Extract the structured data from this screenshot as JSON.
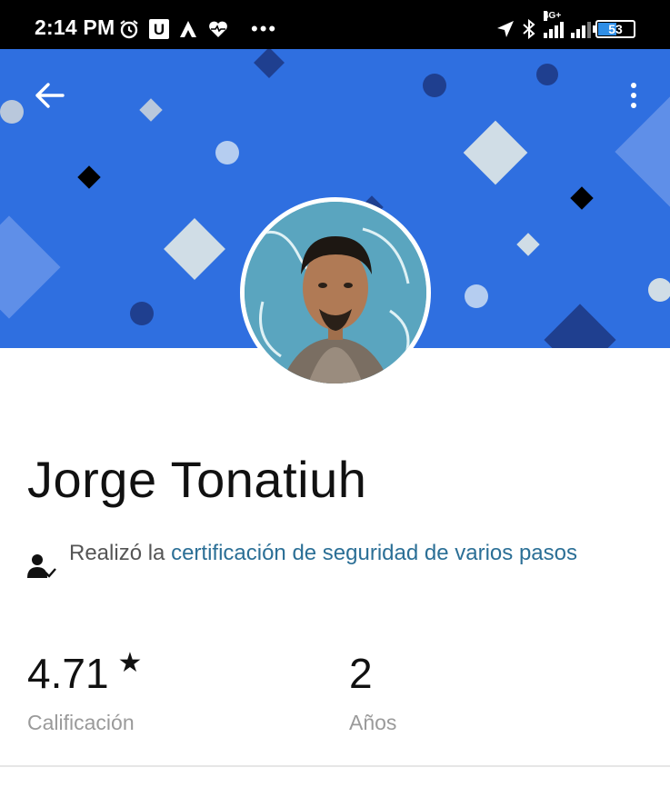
{
  "status_bar": {
    "time": "2:14 PM",
    "u_label": "U",
    "more_label": "•••",
    "network_label": "4G+",
    "battery": "53",
    "left_icons": [
      "alarm-icon",
      "u-app-icon",
      "arch-icon",
      "heart-pulse-icon",
      "more-notifications-icon"
    ],
    "right_icons": [
      "location-arrow-icon",
      "bluetooth-icon",
      "signal-4g-icon",
      "signal-icon",
      "battery-icon"
    ]
  },
  "header": {
    "back_icon": "arrow-left-icon",
    "menu_icon": "more-vertical-icon",
    "banner_color": "#2f6fe0"
  },
  "profile": {
    "name": "Jorge Tonatiuh",
    "verification_prefix": "Realizó la ",
    "verification_link": "certificación de seguridad de varios pasos",
    "verification_icon": "person-check-icon"
  },
  "stats": {
    "rating_value": "4.71",
    "rating_star": "★",
    "rating_label": "Calificación",
    "years_value": "2",
    "years_label": "Años"
  },
  "colors": {
    "accent_link": "#2b6f96",
    "banner": "#2f6fe0"
  }
}
